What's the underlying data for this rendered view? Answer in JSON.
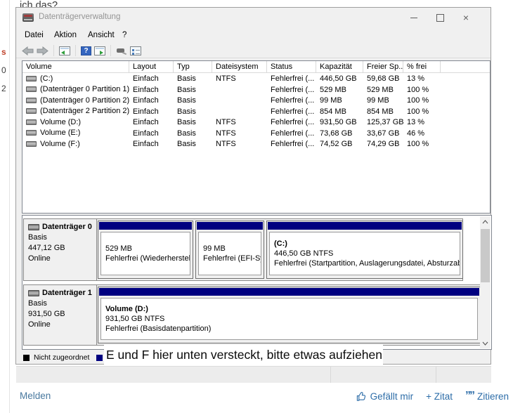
{
  "page": {
    "intro_text": "ich das?",
    "margin_fragments": {
      "a": "s",
      "b": "0",
      "c": "2"
    },
    "footer": {
      "report": "Melden",
      "like": "Gefällt mir",
      "quote_add": "+ Zitat",
      "quote": "Zitieren"
    }
  },
  "icons": {
    "close_glyph": "×",
    "help_glyph": "?",
    "quote_marks": "””"
  },
  "win": {
    "title": "Datenträgerverwaltung",
    "menu": {
      "file": "Datei",
      "action": "Aktion",
      "view": "Ansicht",
      "help": "?"
    },
    "table": {
      "columns": [
        "Volume",
        "Layout",
        "Typ",
        "Dateisystem",
        "Status",
        "Kapazität",
        "Freier Sp...",
        "% frei"
      ],
      "rows": [
        [
          "(C:)",
          "Einfach",
          "Basis",
          "NTFS",
          "Fehlerfrei (...",
          "446,50 GB",
          "59,68 GB",
          "13 %"
        ],
        [
          "(Datenträger 0 Partition 1)",
          "Einfach",
          "Basis",
          "",
          "Fehlerfrei (...",
          "529 MB",
          "529 MB",
          "100 %"
        ],
        [
          "(Datenträger 0 Partition 2)",
          "Einfach",
          "Basis",
          "",
          "Fehlerfrei (...",
          "99 MB",
          "99 MB",
          "100 %"
        ],
        [
          "(Datenträger 2 Partition 2)",
          "Einfach",
          "Basis",
          "",
          "Fehlerfrei (...",
          "854 MB",
          "854 MB",
          "100 %"
        ],
        [
          "Volume (D:)",
          "Einfach",
          "Basis",
          "NTFS",
          "Fehlerfrei (...",
          "931,50 GB",
          "125,37 GB",
          "13 %"
        ],
        [
          "Volume (E:)",
          "Einfach",
          "Basis",
          "NTFS",
          "Fehlerfrei (...",
          "73,68 GB",
          "33,67 GB",
          "46 %"
        ],
        [
          "Volume (F:)",
          "Einfach",
          "Basis",
          "NTFS",
          "Fehlerfrei (...",
          "74,52 GB",
          "74,29 GB",
          "100 %"
        ]
      ]
    },
    "graph": {
      "disks": [
        {
          "name": "Datenträger 0",
          "kind": "Basis",
          "size": "447,12 GB",
          "status": "Online",
          "partitions": [
            {
              "size": "529 MB",
              "status": "Fehlerfrei (Wiederherstellu"
            },
            {
              "size": "99 MB",
              "status": "Fehlerfrei (EFI-Sys"
            },
            {
              "name": "(C:)",
              "size": "446,50 GB NTFS",
              "status": "Fehlerfrei (Startpartition, Auslagerungsdatei, Absturzabb"
            }
          ]
        },
        {
          "name": "Datenträger 1",
          "kind": "Basis",
          "size": "931,50 GB",
          "status": "Online",
          "partitions": [
            {
              "name": "Volume (D:)",
              "size": "931,50 GB NTFS",
              "status": "Fehlerfrei (Basisdatenpartition)"
            }
          ]
        }
      ],
      "legend": {
        "unallocated": "Nicht zugeordnet"
      }
    },
    "annotation": "E und F hier unten versteckt, bitte etwas aufziehen",
    "colors": {
      "partition_band": "#000080",
      "link_blue": "#2d6da8"
    }
  }
}
